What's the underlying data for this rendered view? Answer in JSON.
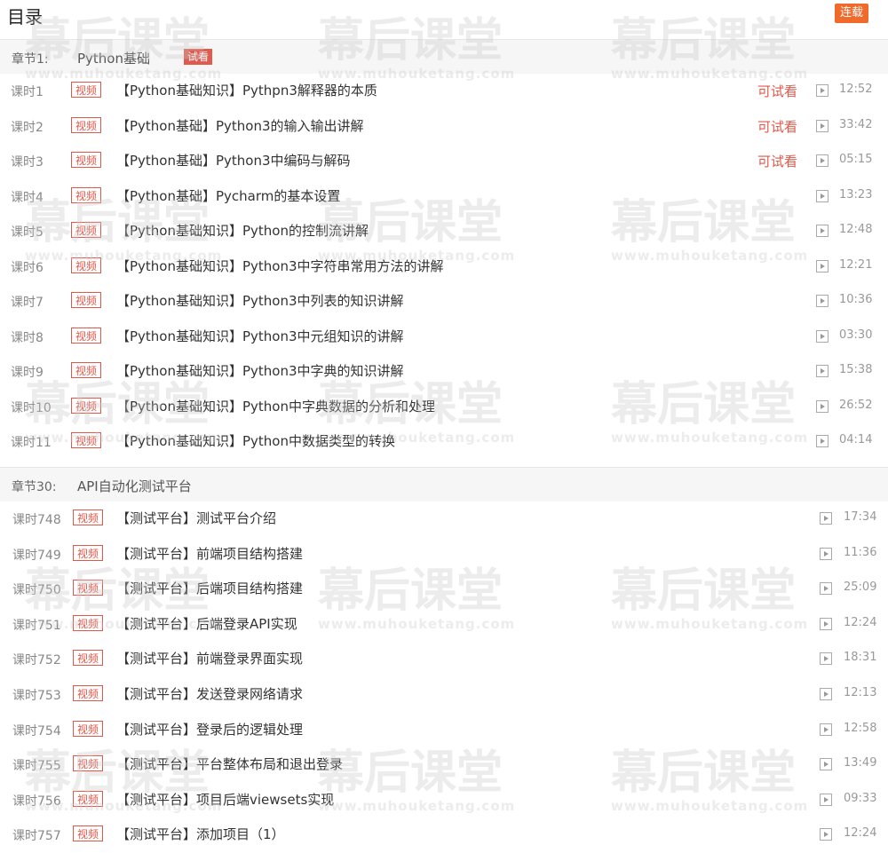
{
  "header": {
    "title": "目录",
    "serial_label": "连载"
  },
  "watermark": {
    "cn": "幕后课堂",
    "en": "www.muhouketang.com"
  },
  "chapters": [
    {
      "num": "章节1:",
      "name": "Python基础",
      "badge": "试看",
      "lessons": [
        {
          "num": "课时1",
          "tag": "视频",
          "title": "【Python基础知识】Pythpn3解释器的本质",
          "trial": "可试看",
          "duration": "12:52"
        },
        {
          "num": "课时2",
          "tag": "视频",
          "title": "【Python基础】Python3的输入输出讲解",
          "trial": "可试看",
          "duration": "33:42"
        },
        {
          "num": "课时3",
          "tag": "视频",
          "title": "【Python基础】Python3中编码与解码",
          "trial": "可试看",
          "duration": "05:15"
        },
        {
          "num": "课时4",
          "tag": "视频",
          "title": "【Python基础】Pycharm的基本设置",
          "trial": "",
          "duration": "13:23"
        },
        {
          "num": "课时5",
          "tag": "视频",
          "title": "【Python基础知识】Python的控制流讲解",
          "trial": "",
          "duration": "12:48"
        },
        {
          "num": "课时6",
          "tag": "视频",
          "title": "【Python基础知识】Python3中字符串常用方法的讲解",
          "trial": "",
          "duration": "12:21"
        },
        {
          "num": "课时7",
          "tag": "视频",
          "title": "【Python基础知识】Python3中列表的知识讲解",
          "trial": "",
          "duration": "10:36"
        },
        {
          "num": "课时8",
          "tag": "视频",
          "title": "【Python基础知识】Python3中元组知识的讲解",
          "trial": "",
          "duration": "03:30"
        },
        {
          "num": "课时9",
          "tag": "视频",
          "title": "【Python基础知识】Python3中字典的知识讲解",
          "trial": "",
          "duration": "15:38"
        },
        {
          "num": "课时10",
          "tag": "视频",
          "title": "【Python基础知识】Python中字典数据的分析和处理",
          "trial": "",
          "duration": "26:52"
        },
        {
          "num": "课时11",
          "tag": "视频",
          "title": "【Python基础知识】Python中数据类型的转换",
          "trial": "",
          "duration": "04:14"
        }
      ]
    },
    {
      "num": "章节30:",
      "name": "API自动化测试平台",
      "badge": "",
      "lessons": [
        {
          "num": "课时748",
          "tag": "视频",
          "title": "【测试平台】测试平台介绍",
          "trial": "",
          "duration": "17:34"
        },
        {
          "num": "课时749",
          "tag": "视频",
          "title": "【测试平台】前端项目结构搭建",
          "trial": "",
          "duration": "11:36"
        },
        {
          "num": "课时750",
          "tag": "视频",
          "title": "【测试平台】后端项目结构搭建",
          "trial": "",
          "duration": "25:09"
        },
        {
          "num": "课时751",
          "tag": "视频",
          "title": "【测试平台】后端登录API实现",
          "trial": "",
          "duration": "12:24"
        },
        {
          "num": "课时752",
          "tag": "视频",
          "title": "【测试平台】前端登录界面实现",
          "trial": "",
          "duration": "18:31"
        },
        {
          "num": "课时753",
          "tag": "视频",
          "title": "【测试平台】发送登录网络请求",
          "trial": "",
          "duration": "12:13"
        },
        {
          "num": "课时754",
          "tag": "视频",
          "title": "【测试平台】登录后的逻辑处理",
          "trial": "",
          "duration": "12:58"
        },
        {
          "num": "课时755",
          "tag": "视频",
          "title": "【测试平台】平台整体布局和退出登录",
          "trial": "",
          "duration": "13:49"
        },
        {
          "num": "课时756",
          "tag": "视频",
          "title": "【测试平台】项目后端viewsets实现",
          "trial": "",
          "duration": "09:33"
        },
        {
          "num": "课时757",
          "tag": "视频",
          "title": "【测试平台】添加项目（1）",
          "trial": "",
          "duration": "12:24"
        }
      ]
    }
  ]
}
